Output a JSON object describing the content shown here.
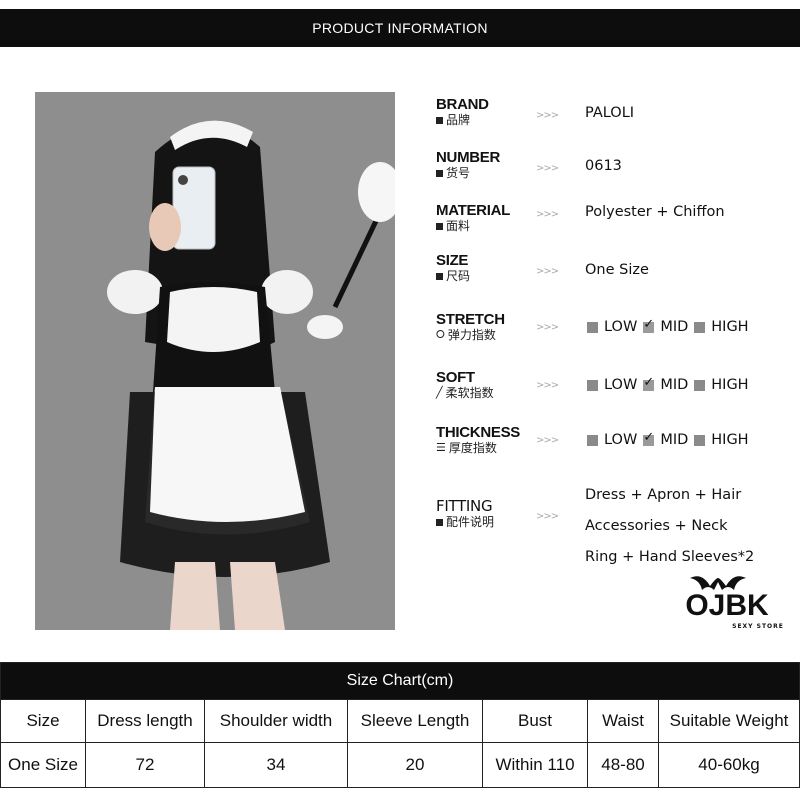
{
  "banner": {
    "title": "PRODUCT INFORMATION"
  },
  "specs": {
    "arrows": ">>>",
    "brand": {
      "en": "BRAND",
      "zh": "品牌",
      "value": "PALOLI"
    },
    "number": {
      "en": "NUMBER",
      "zh": "货号",
      "value": "0613"
    },
    "material": {
      "en": "MATERIAL",
      "zh": "面料",
      "value": "Polyester + Chiffon"
    },
    "size": {
      "en": "SIZE",
      "zh": "尺码",
      "value": "One Size"
    },
    "stretch": {
      "en": "STRETCH",
      "zh": "弹力指数",
      "selected": "MID"
    },
    "soft": {
      "en": "SOFT",
      "zh": "柔软指数",
      "selected": "MID"
    },
    "thickness": {
      "en": "THICKNESS",
      "zh": "厚度指数",
      "selected": "MID"
    },
    "fitting": {
      "en": "FITTING",
      "zh": "配件说明",
      "lines": [
        "Dress + Apron + Hair",
        "Accessories + Neck",
        "Ring + Hand Sleeves*2"
      ]
    },
    "scale_options": [
      "LOW",
      "MID",
      "HIGH"
    ]
  },
  "logo": {
    "text": "OJBK",
    "sub": "SEXY STORE"
  },
  "size_chart": {
    "title": "Size Chart(cm)",
    "headers": [
      "Size",
      "Dress length",
      "Shoulder width",
      "Sleeve Length",
      "Bust",
      "Waist",
      "Suitable Weight"
    ],
    "rows": [
      [
        "One Size",
        "72",
        "34",
        "20",
        "Within 110",
        "48-80",
        "40-60kg"
      ]
    ]
  }
}
